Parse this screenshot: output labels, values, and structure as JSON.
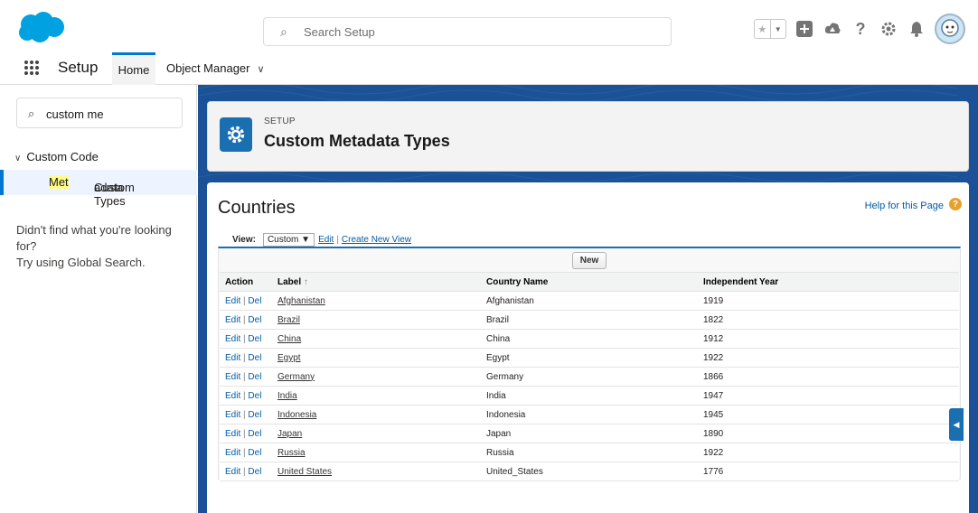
{
  "global_header": {
    "search_placeholder": "Search Setup",
    "icons": [
      "star-icon",
      "chevron-down-icon",
      "add-icon",
      "trailhead-icon",
      "help-icon",
      "gear-icon",
      "bell-icon",
      "avatar"
    ]
  },
  "nav": {
    "app_name": "Setup",
    "tabs": [
      {
        "label": "Home",
        "active": true
      },
      {
        "label": "Object Manager"
      }
    ]
  },
  "sidebar": {
    "quick_find_value": "custom me",
    "group_label": "Custom Code",
    "item_prefix": "Custom ",
    "item_highlight": "Met",
    "item_suffix": "adata Types",
    "not_found_line1": "Didn't find what you're looking for?",
    "not_found_line2": "Try using Global Search."
  },
  "page_header": {
    "eyebrow": "SETUP",
    "title": "Custom Metadata Types"
  },
  "list": {
    "title": "Countries",
    "help_link": "Help for this Page",
    "view_label": "View:",
    "view_value": "Custom",
    "edit_link": "Edit",
    "create_link": "Create New View",
    "new_button": "New",
    "columns": [
      "Action",
      "Label",
      "Country Name",
      "Independent Year"
    ],
    "sort_indicator": "↑",
    "action_edit": "Edit",
    "action_del": "Del",
    "rows": [
      {
        "label": "Afghanistan",
        "country": "Afghanistan",
        "year": "1919"
      },
      {
        "label": "Brazil",
        "country": "Brazil",
        "year": "1822"
      },
      {
        "label": "China",
        "country": "China",
        "year": "1912"
      },
      {
        "label": "Egypt",
        "country": "Egypt",
        "year": "1922"
      },
      {
        "label": "Germany",
        "country": "Germany",
        "year": "1866"
      },
      {
        "label": "India",
        "country": "India",
        "year": "1947"
      },
      {
        "label": "Indonesia",
        "country": "Indonesia",
        "year": "1945"
      },
      {
        "label": "Japan",
        "country": "Japan",
        "year": "1890"
      },
      {
        "label": "Russia",
        "country": "Russia",
        "year": "1922"
      },
      {
        "label": "United States",
        "country": "United_States",
        "year": "1776"
      }
    ]
  },
  "colors": {
    "brand": "#0176d3",
    "banner": "#1b5297",
    "link": "#015ba7"
  }
}
